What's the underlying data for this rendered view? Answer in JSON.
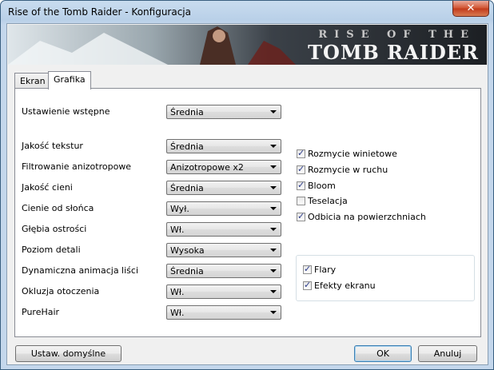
{
  "window": {
    "title": "Rise of the Tomb Raider - Konfiguracja",
    "close_glyph": "✕"
  },
  "banner": {
    "line1": "RISE OF THE",
    "line2": "TOMB RAIDER"
  },
  "tabs": [
    {
      "label": "Ekran"
    },
    {
      "label": "Grafika"
    }
  ],
  "preset": {
    "label": "Ustawienie wstępne",
    "value": "Średnia"
  },
  "settings": [
    {
      "label": "Jakość tekstur",
      "value": "Średnia"
    },
    {
      "label": "Filtrowanie anizotropowe",
      "value": "Anizotropowe x2"
    },
    {
      "label": "Jakość cieni",
      "value": "Średnia"
    },
    {
      "label": "Cienie od słońca",
      "value": "Wył."
    },
    {
      "label": "Głębia ostrości",
      "value": "Wł."
    },
    {
      "label": "Poziom detali",
      "value": "Wysoka"
    },
    {
      "label": "Dynamiczna animacja liści",
      "value": "Średnia"
    },
    {
      "label": "Okluzja otoczenia",
      "value": "Wł."
    },
    {
      "label": "PureHair",
      "value": "Wł."
    }
  ],
  "effects": [
    {
      "label": "Rozmycie winietowe",
      "checked": true
    },
    {
      "label": "Rozmycie w ruchu",
      "checked": true
    },
    {
      "label": "Bloom",
      "checked": true
    },
    {
      "label": "Teselacja",
      "checked": false
    },
    {
      "label": "Odbicia na powierzchniach",
      "checked": true
    }
  ],
  "group_effects": [
    {
      "label": "Flary",
      "checked": true
    },
    {
      "label": "Efekty ekranu",
      "checked": true
    }
  ],
  "buttons": {
    "defaults": "Ustaw. domyślne",
    "ok": "OK",
    "cancel": "Anuluj"
  },
  "check_glyph": "✓"
}
